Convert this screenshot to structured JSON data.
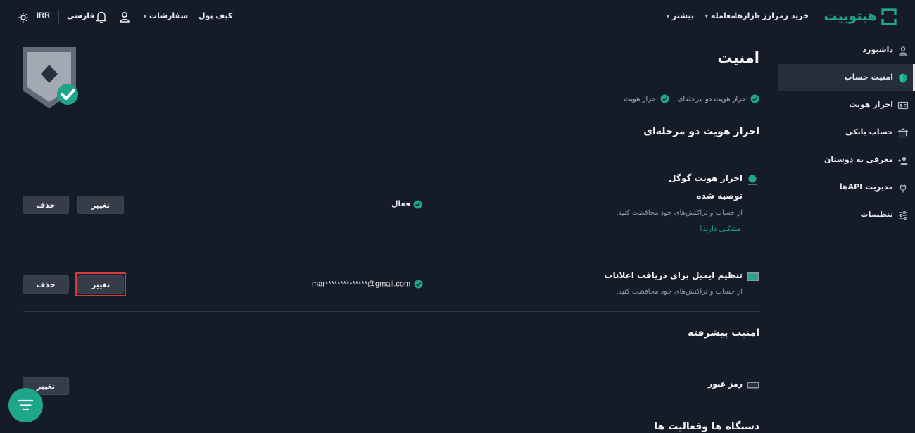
{
  "header": {
    "brand": "هیتوبیت",
    "nav": [
      {
        "label": "خرید رمزارز",
        "has_caret": true
      },
      {
        "label": "بازارها",
        "has_caret": false
      },
      {
        "label": "معامله",
        "has_caret": true
      },
      {
        "label": "بیشتر",
        "has_caret": true
      }
    ],
    "wallet_label": "کیف پول",
    "orders_label": "سفارشات",
    "language_label": "فارسی",
    "currency_label": "IRR",
    "icons": {
      "user": "user-icon",
      "bell": "bell-icon",
      "theme": "sun-icon"
    }
  },
  "sidebar": {
    "items": [
      {
        "label": "داشبورد",
        "icon": "user-outline-icon",
        "active": false
      },
      {
        "label": "امنیت حساب",
        "icon": "shield-icon",
        "active": true
      },
      {
        "label": "احراز هویت",
        "icon": "id-card-icon",
        "active": false
      },
      {
        "label": "حساب بانکی",
        "icon": "bank-icon",
        "active": false
      },
      {
        "label": "معرفی به دوستان",
        "icon": "user-plus-icon",
        "active": false
      },
      {
        "label": "مدیریت APIها",
        "icon": "plug-icon",
        "active": false
      },
      {
        "label": "تنظیمات",
        "icon": "sliders-icon",
        "active": false
      }
    ]
  },
  "main": {
    "page_title": "امنیت",
    "status_badges": [
      "احراز هویت دو مرحله‌ای",
      "احراز هویت"
    ],
    "two_factor": {
      "section_title": "احراز هویت دو مرحله‌ای",
      "google": {
        "title": "احراز هویت گوگل",
        "recommended": "توصیه شده",
        "description": "از حساب و تراکنش‌های خود محافظت کنید.",
        "help_link": "مشکلی دارید؟",
        "status": "فعال",
        "change_label": "تغییر",
        "delete_label": "حذف"
      },
      "email": {
        "title": "تنظیم ایمیل برای دریافت اعلانات",
        "description": "از حساب و تراکنش‌های خود محافظت کنید.",
        "value": "mar**************@gmail.com",
        "change_label": "تغییر",
        "delete_label": "حذف"
      }
    },
    "advanced": {
      "section_title": "امنیت پیشرفته",
      "password_label": "رمز عبور",
      "change_label": "تغییر"
    },
    "devices_title": "دستگاه ها وفعالیت ها"
  },
  "colors": {
    "background": "#161c27",
    "accent": "#1ea58a",
    "highlight_border": "#d83b3b",
    "button": "#363d49",
    "sidebar_active": "#262d3b"
  },
  "fab_icon": "filter-lines-icon"
}
